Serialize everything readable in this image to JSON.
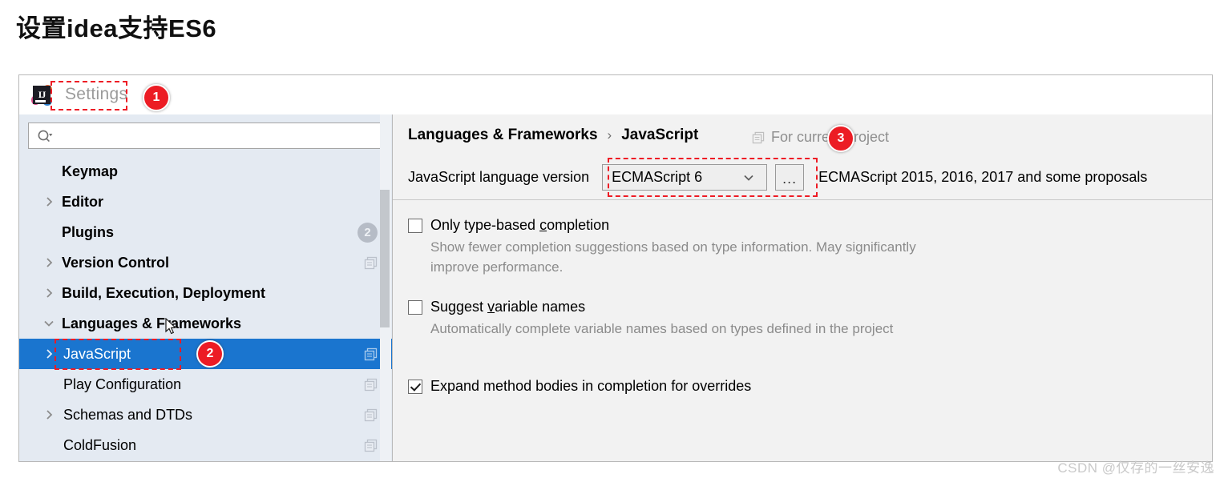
{
  "page": {
    "title": "设置idea支持ES6",
    "watermark": "CSDN @仅存的一丝安逸"
  },
  "window": {
    "title": "Settings",
    "logo_icon": "intellij-idea-logo-icon"
  },
  "sidebar": {
    "search": {
      "value": "",
      "placeholder": "",
      "icon": "search-icon"
    },
    "items": [
      {
        "label": "Keymap",
        "level": 0,
        "arrow": "none",
        "bold": true,
        "badge": "",
        "copy_icon": false
      },
      {
        "label": "Editor",
        "level": 0,
        "arrow": "right",
        "bold": true,
        "badge": "",
        "copy_icon": false
      },
      {
        "label": "Plugins",
        "level": 0,
        "arrow": "none",
        "bold": true,
        "badge": "2",
        "copy_icon": false
      },
      {
        "label": "Version Control",
        "level": 0,
        "arrow": "right",
        "bold": true,
        "badge": "",
        "copy_icon": true
      },
      {
        "label": "Build, Execution, Deployment",
        "level": 0,
        "arrow": "right",
        "bold": true,
        "badge": "",
        "copy_icon": false
      },
      {
        "label": "Languages & Frameworks",
        "level": 0,
        "arrow": "down",
        "bold": true,
        "badge": "",
        "copy_icon": false
      },
      {
        "label": "JavaScript",
        "level": 1,
        "arrow": "right",
        "bold": false,
        "badge": "",
        "copy_icon": true,
        "selected": true
      },
      {
        "label": "Play Configuration",
        "level": 1,
        "arrow": "none",
        "bold": false,
        "badge": "",
        "copy_icon": true
      },
      {
        "label": "Schemas and DTDs",
        "level": 1,
        "arrow": "right",
        "bold": false,
        "badge": "",
        "copy_icon": true
      },
      {
        "label": "ColdFusion",
        "level": 1,
        "arrow": "none",
        "bold": false,
        "badge": "",
        "copy_icon": true
      }
    ]
  },
  "main": {
    "breadcrumb": {
      "parent": "Languages & Frameworks",
      "separator": "›",
      "current": "JavaScript"
    },
    "for_project": {
      "label": "For current project",
      "icon": "copy-settings-icon"
    },
    "version_row": {
      "label": "JavaScript language version",
      "value": "ECMAScript 6",
      "chevron_icon": "chevron-down-icon",
      "ellipsis_label": "...",
      "note": "ECMAScript 2015, 2016, 2017 and some proposals"
    },
    "options": [
      {
        "title_pre": "Only type-based ",
        "title_mnemonic": "c",
        "title_post": "ompletion",
        "checked": false,
        "description": "Show fewer completion suggestions based on type information. May significantly improve performance."
      },
      {
        "title_pre": "Suggest ",
        "title_mnemonic": "v",
        "title_post": "ariable names",
        "checked": false,
        "description": "Automatically complete variable names based on types defined in the project"
      },
      {
        "title_pre": "Expand method bodies in completion for overrides",
        "title_mnemonic": "",
        "title_post": "",
        "checked": true,
        "description": ""
      }
    ]
  },
  "annotations": {
    "badges": [
      {
        "number": "1",
        "target": "settings-title"
      },
      {
        "number": "2",
        "target": "sidebar-item-javascript"
      },
      {
        "number": "3",
        "target": "for-current-project"
      }
    ],
    "highlight_color": "#ee1c25"
  }
}
